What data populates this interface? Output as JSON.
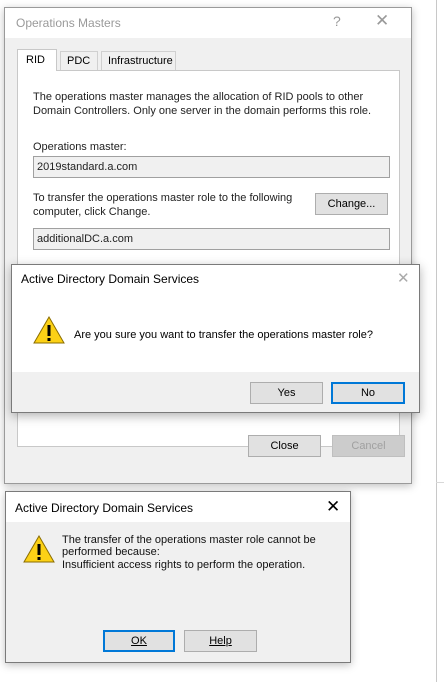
{
  "ops_dialog": {
    "title": "Operations Masters",
    "help_glyph": "?",
    "close_glyph": "✕",
    "tabs": [
      {
        "label": "RID"
      },
      {
        "label": "PDC"
      },
      {
        "label": "Infrastructure"
      }
    ],
    "description": "The operations master manages the allocation of RID pools to other Domain Controllers. Only one server in the domain performs this role.",
    "operations_master_label": "Operations master:",
    "operations_master_value": "2019standard.a.com",
    "transfer_label": "To transfer the operations master role to the following computer, click Change.",
    "change_button": "Change...",
    "target_value": "additionalDC.a.com",
    "close_button": "Close",
    "cancel_button": "Cancel"
  },
  "confirm_dialog": {
    "title": "Active Directory Domain Services",
    "close_glyph": "✕",
    "icon": "warning-icon",
    "message": "Are you sure you want to transfer the operations master role?",
    "yes_button": "Yes",
    "no_button": "No"
  },
  "error_dialog": {
    "title": "Active Directory Domain Services",
    "close_glyph": "✕",
    "icon": "warning-icon",
    "message_line1": "The transfer of the operations master role cannot be",
    "message_line2": "performed because:",
    "message_line3": "Insufficient access rights to perform the operation.",
    "ok_button": "OK",
    "help_button": "Help"
  },
  "colors": {
    "dialog_bg": "#f0f0f0",
    "accent_focus": "#0078d7",
    "warning_fill": "#fcd116"
  }
}
